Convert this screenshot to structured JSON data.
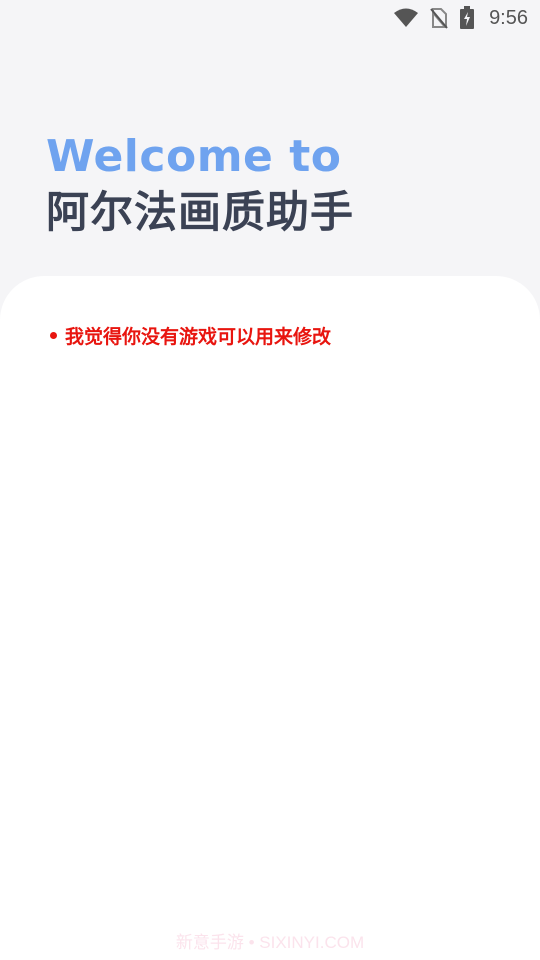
{
  "status_bar": {
    "time": "9:56",
    "icons": [
      "wifi-icon",
      "no-sim-icon",
      "battery-charging-icon"
    ]
  },
  "header": {
    "welcome": "Welcome to",
    "app_name": "阿尔法画质助手"
  },
  "notice": {
    "text": "我觉得你没有游戏可以用来修改",
    "color": "#e8150f"
  },
  "watermark": "新意手游 • SIXINYI.COM",
  "colors": {
    "background": "#f5f5f7",
    "card": "#ffffff",
    "welcome_accent": "#6fa3ef",
    "title": "#3b4254"
  }
}
